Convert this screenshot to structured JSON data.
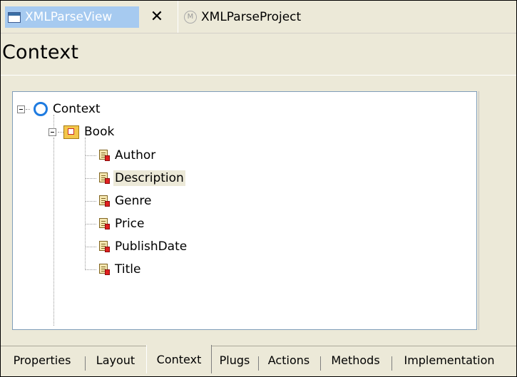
{
  "window": {
    "active_tab": {
      "label": "XMLParseView",
      "close_glyph": "✕"
    },
    "second_tab": {
      "label": "XMLParseProject",
      "icon": "M"
    }
  },
  "header": {
    "title": "Context"
  },
  "tree": {
    "root": {
      "label": "Context",
      "icon": "context-node-icon"
    },
    "node": {
      "label": "Book",
      "icon": "node-icon"
    },
    "attributes": [
      {
        "label": "Author"
      },
      {
        "label": "Description",
        "selected": true
      },
      {
        "label": "Genre"
      },
      {
        "label": "Price"
      },
      {
        "label": "PublishDate"
      },
      {
        "label": "Title"
      }
    ]
  },
  "bottom_tabs": [
    {
      "label": "Properties"
    },
    {
      "label": "Layout"
    },
    {
      "label": "Context",
      "active": true
    },
    {
      "label": "Plugs"
    },
    {
      "label": "Actions"
    },
    {
      "label": "Methods"
    },
    {
      "label": "Implementation"
    }
  ],
  "colors": {
    "accent": "#a6caf0",
    "context_icon": "#1e7be0",
    "panel_bg": "#ece9d8"
  }
}
